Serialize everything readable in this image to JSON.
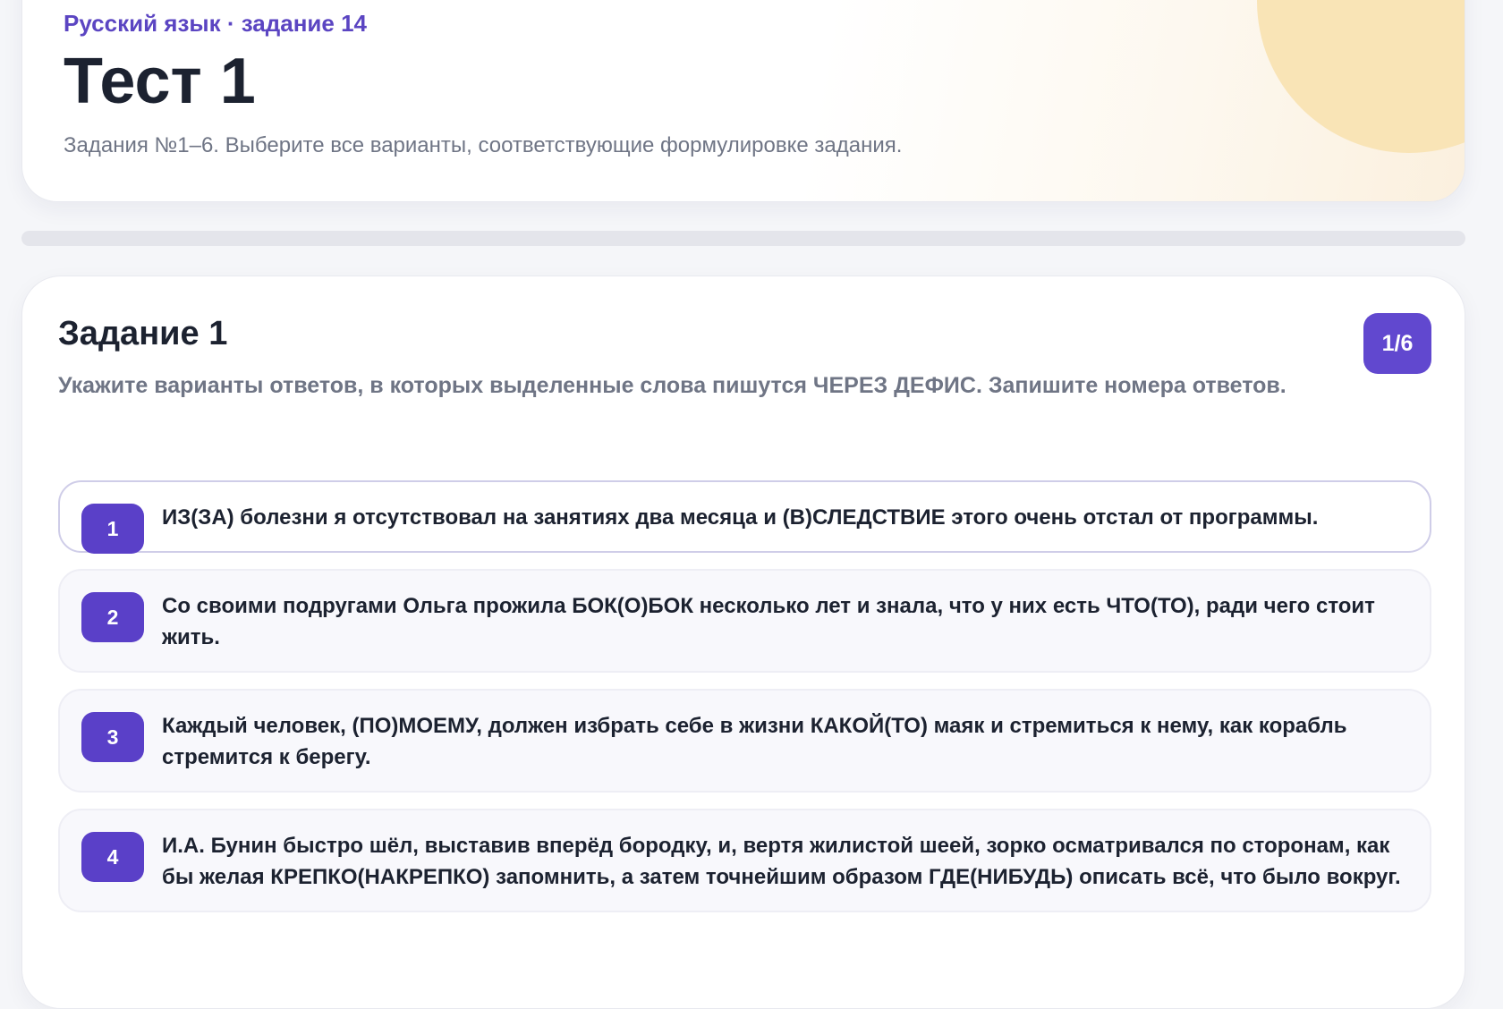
{
  "header": {
    "subject": "Русский язык · задание 14",
    "title": "Тест 1",
    "description": "Задания №1–6. Выберите все варианты, соответствующие формулировке задания."
  },
  "progress": {
    "fraction": 0
  },
  "task": {
    "title": "Задание 1",
    "counter": "1/6",
    "instruction": "Укажите варианты ответов, в которых выделенные слова пишутся ЧЕРЕЗ ДЕФИС. Запишите номера ответов.",
    "options": [
      {
        "number": "1",
        "text": "ИЗ(ЗА) болезни я отсутствовал на занятиях два месяца и (В)СЛЕДСТВИЕ этого очень отстал от программы."
      },
      {
        "number": "2",
        "text": "Со своими подругами Ольга прожила БОК(О)БОК несколько лет и знала, что у них есть ЧТО(ТО), ради чего стоит жить."
      },
      {
        "number": "3",
        "text": "Каждый человек, (ПО)МОЕМУ, должен избрать себе в жизни КАКОЙ(ТО) маяк и стремиться к нему, как корабль стремится к берегу."
      },
      {
        "number": "4",
        "text": "И.А. Бунин быстро шёл, выставив вперёд бородку, и, вертя жилистой шеей, зорко осматривался по сторонам, как бы желая КРЕПКО(НАКРЕПКО) запомнить, а затем точнейшим образом ГДЕ(НИБУДЬ) описать всё, что было вокруг."
      }
    ]
  },
  "colors": {
    "accent": "#5b45c2",
    "badge": "#5a40c8",
    "text_primary": "#1c2230",
    "text_muted": "#6f7585",
    "sun_decor": "#f9e4b6"
  }
}
